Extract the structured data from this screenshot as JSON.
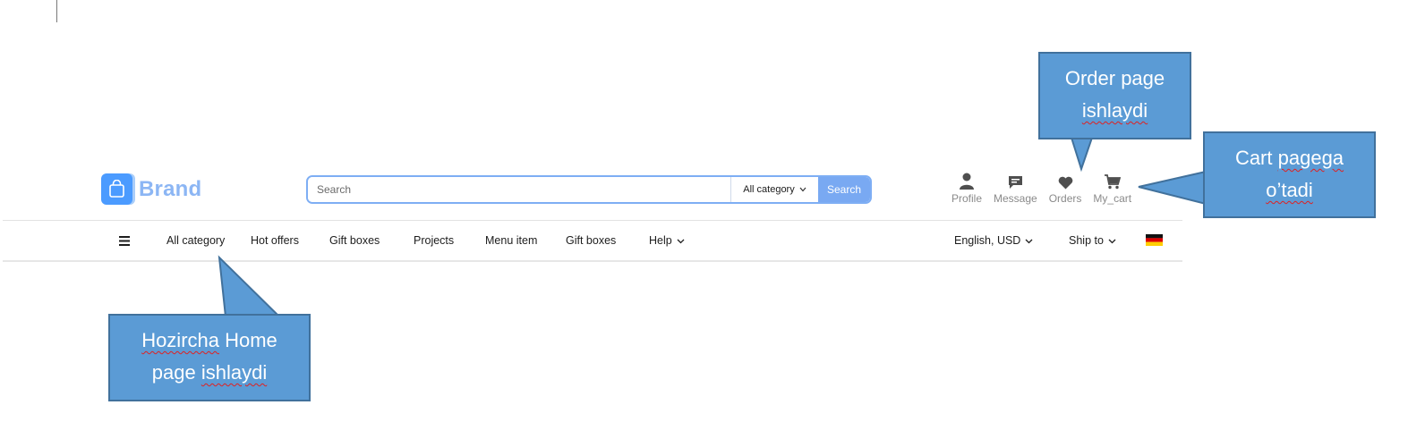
{
  "header": {
    "brand": {
      "name": "Brand",
      "logo_icon": "shopping-bag-icon",
      "accent": "#4b9bff"
    },
    "search": {
      "placeholder": "Search",
      "value": "",
      "category": "All category",
      "button_label": "Search"
    },
    "actions": [
      {
        "label": "Profile",
        "icon": "user-icon"
      },
      {
        "label": "Message",
        "icon": "message-icon"
      },
      {
        "label": "Orders",
        "icon": "heart-icon"
      },
      {
        "label": "My_cart",
        "icon": "cart-icon"
      }
    ]
  },
  "nav": {
    "menu_icon": "hamburger-menu-icon",
    "items": [
      "All category",
      "Hot offers",
      "Gift boxes",
      "Projects",
      "Menu item",
      "Gift boxes"
    ],
    "help": "Help",
    "language": "English, USD",
    "ship_to": "Ship to",
    "flag": "germany-flag-icon"
  },
  "annotations": {
    "orders": {
      "line1": "Order page",
      "line2": "ishlaydi"
    },
    "cart": {
      "line1a": "Cart ",
      "line1b": "pagega",
      "line2": "o’tadi"
    },
    "home": {
      "line1a": "Hozircha",
      "line1b": " Home",
      "line2a": "page ",
      "line2b": "ishlaydi"
    }
  },
  "colors": {
    "callout_fill": "#5b9bd5",
    "callout_border": "#41719c",
    "search_button": "#79a9f2",
    "spellcheck_underline": "#e02020"
  }
}
